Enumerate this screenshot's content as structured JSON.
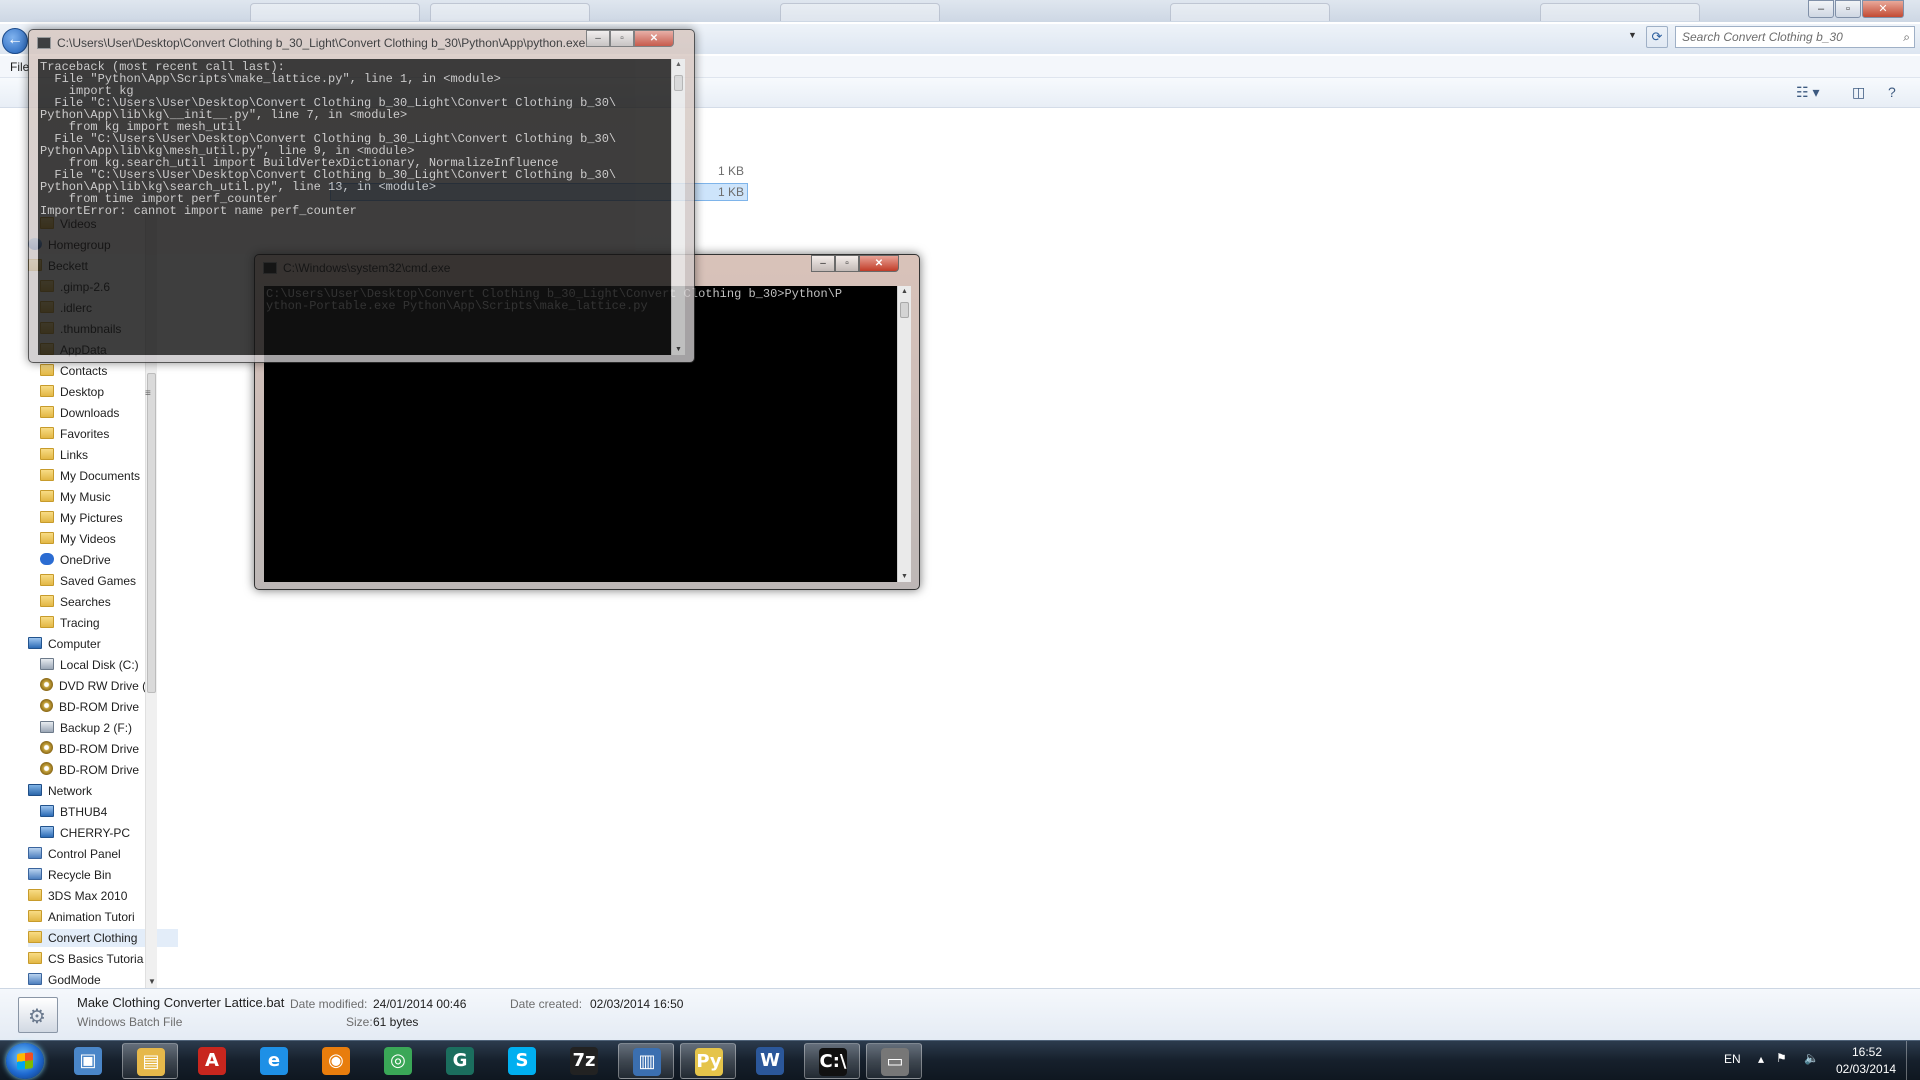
{
  "explorer": {
    "search_placeholder": "Search Convert Clothing b_30",
    "menu_file": "File",
    "file_sizes": [
      "1 KB",
      "1 KB"
    ],
    "nav_items": [
      {
        "label": "Videos",
        "icon": "folder"
      },
      {
        "label": "Homegroup",
        "icon": "home"
      },
      {
        "label": "Beckett",
        "icon": "folder"
      },
      {
        "label": ".gimp-2.6",
        "icon": "folder"
      },
      {
        "label": ".idlerc",
        "icon": "folder"
      },
      {
        "label": ".thumbnails",
        "icon": "folder"
      },
      {
        "label": "AppData",
        "icon": "folder"
      },
      {
        "label": "Contacts",
        "icon": "folder"
      },
      {
        "label": "Desktop",
        "icon": "folder"
      },
      {
        "label": "Downloads",
        "icon": "folder"
      },
      {
        "label": "Favorites",
        "icon": "folder"
      },
      {
        "label": "Links",
        "icon": "folder"
      },
      {
        "label": "My Documents",
        "icon": "folder"
      },
      {
        "label": "My Music",
        "icon": "folder"
      },
      {
        "label": "My Pictures",
        "icon": "folder"
      },
      {
        "label": "My Videos",
        "icon": "folder"
      },
      {
        "label": "OneDrive",
        "icon": "onedrive"
      },
      {
        "label": "Saved Games",
        "icon": "folder"
      },
      {
        "label": "Searches",
        "icon": "folder"
      },
      {
        "label": "Tracing",
        "icon": "folder"
      },
      {
        "label": "Computer",
        "icon": "pc"
      },
      {
        "label": "Local Disk (C:)",
        "icon": "drive"
      },
      {
        "label": "DVD RW Drive (",
        "icon": "disc"
      },
      {
        "label": "BD-ROM Drive",
        "icon": "disc"
      },
      {
        "label": "Backup 2 (F:)",
        "icon": "drive"
      },
      {
        "label": "BD-ROM Drive",
        "icon": "disc"
      },
      {
        "label": "BD-ROM Drive",
        "icon": "disc"
      },
      {
        "label": "Network",
        "icon": "net"
      },
      {
        "label": "BTHUB4",
        "icon": "pc"
      },
      {
        "label": "CHERRY-PC",
        "icon": "pc"
      },
      {
        "label": "Control Panel",
        "icon": "cp"
      },
      {
        "label": "Recycle Bin",
        "icon": "cp"
      },
      {
        "label": "3DS Max 2010",
        "icon": "folder"
      },
      {
        "label": "Animation Tutori",
        "icon": "folder"
      },
      {
        "label": "Convert Clothing",
        "icon": "folder"
      },
      {
        "label": "CS Basics  Tutoria",
        "icon": "folder"
      },
      {
        "label": "GodMode",
        "icon": "cp"
      }
    ],
    "details": {
      "file_name": "Make Clothing Converter Lattice.bat",
      "file_type": "Windows Batch File",
      "modified_label": "Date modified:",
      "modified_value": "24/01/2014 00:46",
      "size_label": "Size:",
      "size_value": "61 bytes",
      "created_label": "Date created:",
      "created_value": "02/03/2014 16:50"
    }
  },
  "python_window": {
    "title": "C:\\Users\\User\\Desktop\\Convert Clothing b_30_Light\\Convert Clothing b_30\\Python\\App\\python.exe",
    "output": "Traceback (most recent call last):\n  File \"Python\\App\\Scripts\\make_lattice.py\", line 1, in <module>\n    import kg\n  File \"C:\\Users\\User\\Desktop\\Convert Clothing b_30_Light\\Convert Clothing b_30\\\nPython\\App\\lib\\kg\\__init__.py\", line 7, in <module>\n    from kg import mesh_util\n  File \"C:\\Users\\User\\Desktop\\Convert Clothing b_30_Light\\Convert Clothing b_30\\\nPython\\App\\lib\\kg\\mesh_util.py\", line 9, in <module>\n    from kg.search_util import BuildVertexDictionary, NormalizeInfluence\n  File \"C:\\Users\\User\\Desktop\\Convert Clothing b_30_Light\\Convert Clothing b_30\\\nPython\\App\\lib\\kg\\search_util.py\", line 13, in <module>\n    from time import perf_counter\nImportError: cannot import name perf_counter"
  },
  "cmd_window": {
    "title": "C:\\Windows\\system32\\cmd.exe",
    "output": "C:\\Users\\User\\Desktop\\Convert Clothing b_30_Light\\Convert Clothing b_30>Python\\P\nython-Portable.exe Python\\App\\Scripts\\make_lattice.py"
  },
  "taskbar": {
    "apps": [
      {
        "name": "explorer-computer",
        "glyph": "▣",
        "color": "#4a86c8"
      },
      {
        "name": "file-explorer",
        "glyph": "▤",
        "color": "#e6b84a"
      },
      {
        "name": "adobe",
        "glyph": "A",
        "color": "#c8261e"
      },
      {
        "name": "internet-explorer",
        "glyph": "e",
        "color": "#1e90e6"
      },
      {
        "name": "blender",
        "glyph": "◉",
        "color": "#e87d0d"
      },
      {
        "name": "chrome",
        "glyph": "◎",
        "color": "#3aa757"
      },
      {
        "name": "steam-like",
        "glyph": "G",
        "color": "#1b6e5e"
      },
      {
        "name": "skype",
        "glyph": "S",
        "color": "#00aff0"
      },
      {
        "name": "seven-zip",
        "glyph": "7z",
        "color": "#222222"
      },
      {
        "name": "remote-desktop",
        "glyph": "▥",
        "color": "#3b6fb0"
      },
      {
        "name": "python",
        "glyph": "Py",
        "color": "#e5c44a"
      },
      {
        "name": "word",
        "glyph": "W",
        "color": "#2b579a"
      },
      {
        "name": "cmd",
        "glyph": "C:\\",
        "color": "#111111"
      },
      {
        "name": "window-generic",
        "glyph": "▭",
        "color": "#777777"
      }
    ],
    "language": "EN",
    "time": "16:52",
    "date": "02/03/2014"
  }
}
